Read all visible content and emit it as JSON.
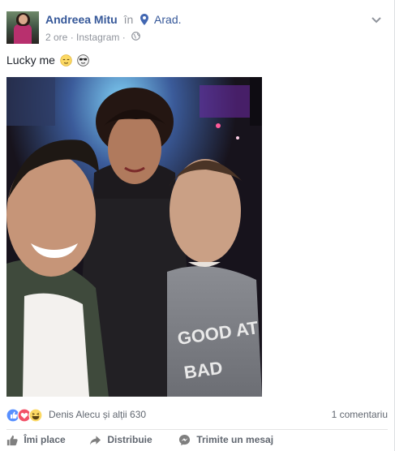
{
  "post": {
    "author": "Andreea Mitu",
    "in_word": "în",
    "place": "Arad.",
    "time": "2 ore",
    "separator": "·",
    "source": "Instagram",
    "separator2": "·",
    "text": "Lucky me",
    "emojis": [
      "relieved-face",
      "sunglasses-face"
    ]
  },
  "reactions": {
    "icons": [
      "like",
      "love",
      "haha"
    ],
    "summary": "Denis Alecu și alții 630",
    "comments": "1 comentariu"
  },
  "actions": {
    "like": "Îmi place",
    "share": "Distribuie",
    "message": "Trimite un mesaj"
  },
  "colors": {
    "link": "#365899",
    "meta": "#90949c",
    "like_blue": "#5890ff",
    "love_red": "#f25268",
    "haha_yellow": "#fcd964"
  }
}
